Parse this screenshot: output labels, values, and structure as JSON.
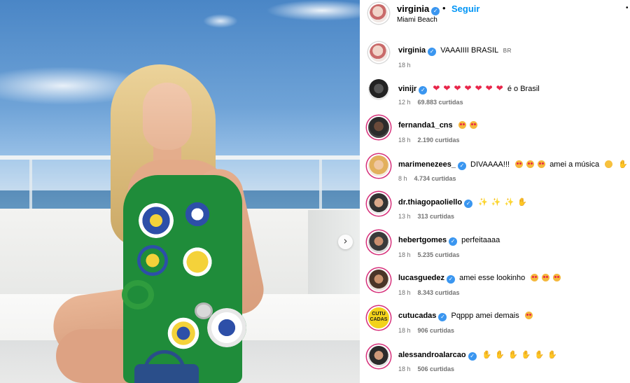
{
  "post": {
    "next_icon": "chevron-right-icon"
  },
  "header": {
    "username": "virginia",
    "follow_label": "Seguir",
    "location": "Miami Beach",
    "more_icon": "dot-icon"
  },
  "comments": [
    {
      "username": "virginia",
      "verified": true,
      "text": "VAAAIIII BRASIL",
      "flag": "BR",
      "time": "18 h",
      "likes": ""
    },
    {
      "username": "vinijr",
      "verified": true,
      "text": "é o Brasil",
      "emoji": "hearts",
      "time": "12 h",
      "likes": "69.883 curtidas"
    },
    {
      "username": "fernanda1_cns",
      "verified": false,
      "text": "",
      "emoji": "hearteyes2",
      "time": "18 h",
      "likes": "2.190 curtidas"
    },
    {
      "username": "marimenezees_",
      "verified": true,
      "text": "DIVAAAA!!!",
      "text2": "amei a música",
      "time": "8 h",
      "likes": "4.734 curtidas"
    },
    {
      "username": "dr.thiagopaoliello",
      "verified": true,
      "text": "",
      "time": "13 h",
      "likes": "313 curtidas"
    },
    {
      "username": "hebertgomes",
      "verified": true,
      "text": "perfeitaaaa",
      "time": "18 h",
      "likes": "5.235 curtidas"
    },
    {
      "username": "lucasguedez",
      "verified": true,
      "text": "amei esse lookinho",
      "time": "18 h",
      "likes": "8.343 curtidas"
    },
    {
      "username": "cutucadas",
      "verified": true,
      "text": "Pqppp amei demais",
      "time": "18 h",
      "likes": "906 curtidas"
    },
    {
      "username": "alessandroalarcao",
      "verified": true,
      "text": "",
      "time": "18 h",
      "likes": "506 curtidas"
    }
  ],
  "colors": {
    "accent": "#0095f6",
    "verified": "#3a96f0",
    "meta": "#737373"
  }
}
